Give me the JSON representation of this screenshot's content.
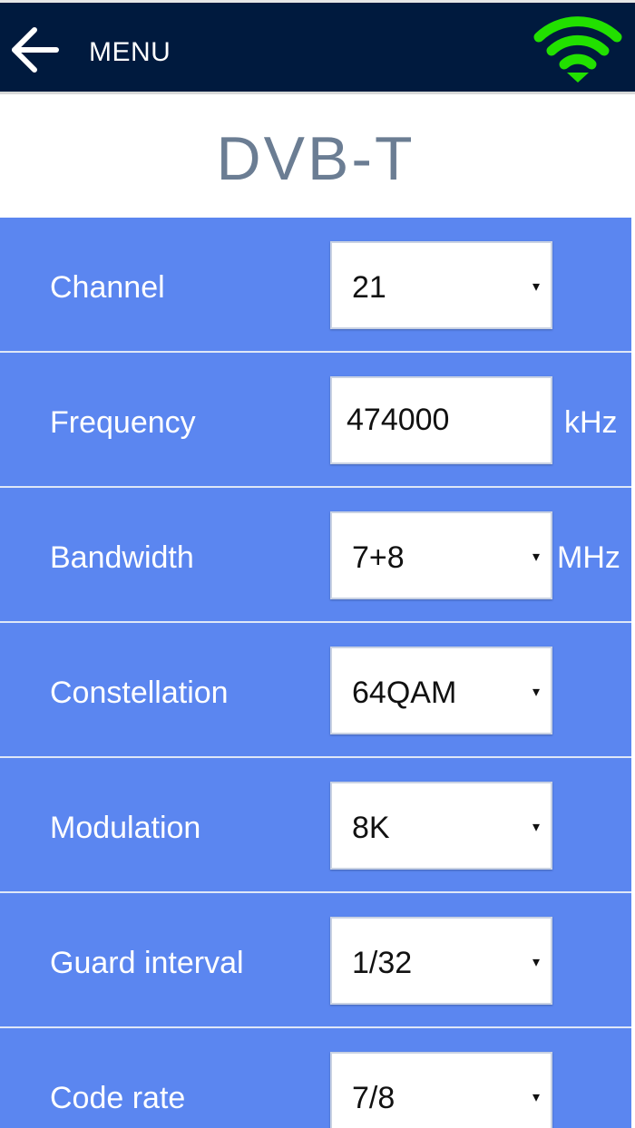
{
  "header": {
    "menu_label": "MENU",
    "back_icon": "arrow-left-icon",
    "wifi_icon": "wifi-icon",
    "wifi_color": "#22e000",
    "bar_color": "#001a3e"
  },
  "page": {
    "title": "DVB-T",
    "background_color": "#5b86f0"
  },
  "settings": {
    "channel": {
      "label": "Channel",
      "value": "21"
    },
    "frequency": {
      "label": "Frequency",
      "value": "474000",
      "unit": "kHz"
    },
    "bandwidth": {
      "label": "Bandwidth",
      "value": "7+8",
      "unit": "MHz"
    },
    "constellation": {
      "label": "Constellation",
      "value": "64QAM"
    },
    "modulation": {
      "label": "Modulation",
      "value": "8K"
    },
    "guard_interval": {
      "label": "Guard interval",
      "value": "1/32"
    },
    "code_rate": {
      "label": "Code rate",
      "value": "7/8"
    }
  },
  "dropdown_caret": "▾"
}
